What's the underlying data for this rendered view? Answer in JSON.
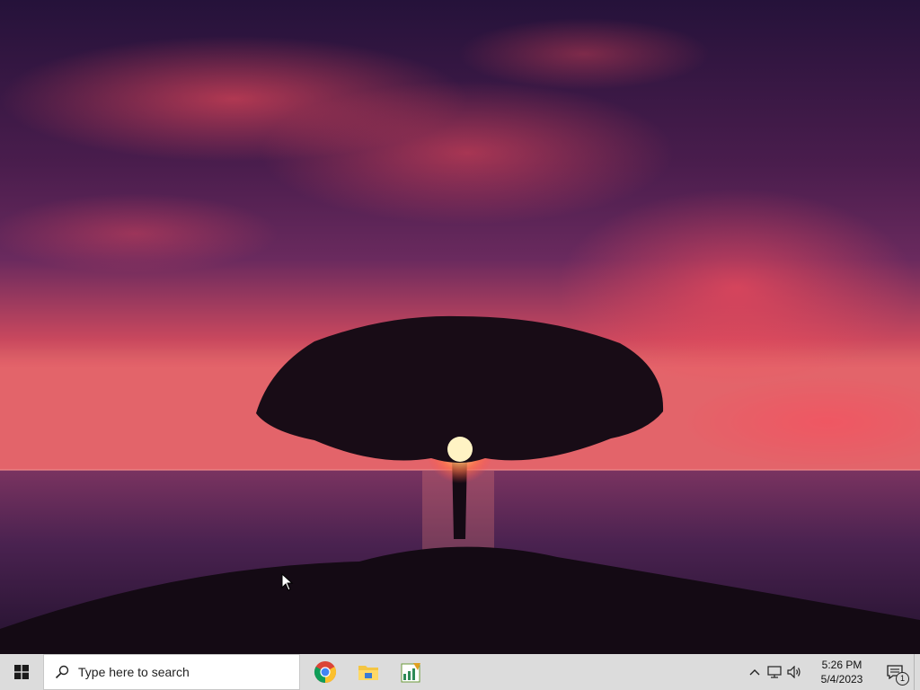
{
  "desktop": {
    "wallpaper_name": "sunset-tree-wallpaper"
  },
  "taskbar": {
    "start_icon": "windows-logo-icon",
    "search": {
      "placeholder": "Type here to search",
      "icon": "search-icon"
    },
    "pinned": [
      {
        "name": "chrome",
        "icon": "chrome-icon"
      },
      {
        "name": "file-explorer",
        "icon": "folder-icon"
      },
      {
        "name": "spreadsheet-app",
        "icon": "spreadsheet-icon"
      }
    ],
    "tray": {
      "chevron_icon": "chevron-up-icon",
      "network_icon": "network-icon",
      "volume_icon": "volume-icon",
      "time": "5:26 PM",
      "date": "5/4/2023",
      "notification_count": "1"
    }
  },
  "colors": {
    "taskbar_bg": "#dcdcdc",
    "sky_top": "#2a1640",
    "sky_red": "#e0455a",
    "sea": "#3a1d42"
  }
}
